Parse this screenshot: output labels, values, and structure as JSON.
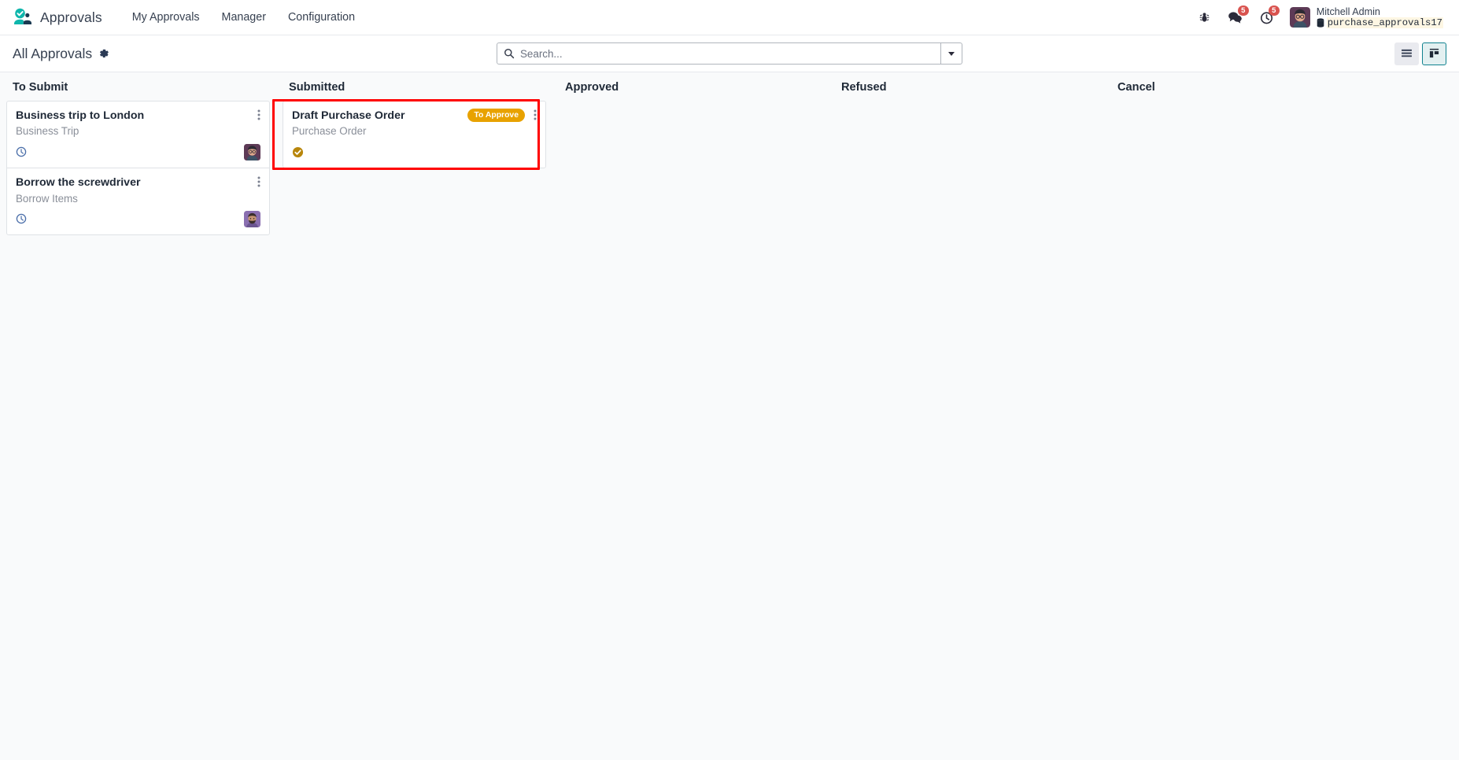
{
  "navbar": {
    "brand": "Approvals",
    "brand_logo_icon": "approvals-person-check-logo",
    "menu_items": [
      {
        "label": "My Approvals",
        "name": "my-approvals"
      },
      {
        "label": "Manager",
        "name": "manager"
      },
      {
        "label": "Configuration",
        "name": "configuration"
      }
    ],
    "systray": {
      "debug_icon": "bug-icon",
      "messages_icon": "messages-icon",
      "messages_count": "5",
      "activities_icon": "clock-activity-icon",
      "activities_count": "5"
    },
    "user": {
      "avatar_icon": "user-avatar",
      "name": "Mitchell Admin",
      "database_icon": "database-icon",
      "database": "purchase_approvals17"
    }
  },
  "control_panel": {
    "breadcrumb_title": "All Approvals",
    "gear_icon": "gear-icon",
    "search": {
      "icon": "search-icon",
      "placeholder": "Search...",
      "value": "",
      "toggle_icon": "chevron-down-icon"
    },
    "view_switcher": [
      {
        "name": "list-view",
        "icon": "list-icon",
        "active": false
      },
      {
        "name": "kanban-view",
        "icon": "kanban-icon",
        "active": true
      }
    ]
  },
  "kanban": {
    "columns": [
      {
        "title": "To Submit",
        "name": "to-submit",
        "cards": [
          {
            "title": "Business trip to London",
            "subtitle": "Business Trip",
            "badge": "",
            "footer_icon": "clock-icon",
            "avatar_icon": "avatar-mitchell-admin",
            "menu_icon": "kebab-menu-icon"
          },
          {
            "title": "Borrow the screwdriver",
            "subtitle": "Borrow Items",
            "badge": "",
            "footer_icon": "clock-icon",
            "avatar_icon": "avatar-user-purple",
            "menu_icon": "kebab-menu-icon"
          }
        ]
      },
      {
        "title": "Submitted",
        "name": "submitted",
        "cards": [
          {
            "title": "Draft Purchase Order",
            "subtitle": "Purchase Order",
            "badge": "To Approve",
            "footer_icon": "check-circle-icon",
            "avatar_icon": "",
            "menu_icon": "kebab-menu-icon"
          }
        ]
      },
      {
        "title": "Approved",
        "name": "approved",
        "cards": []
      },
      {
        "title": "Refused",
        "name": "refused",
        "cards": []
      },
      {
        "title": "Cancel",
        "name": "cancel",
        "cards": []
      }
    ]
  },
  "colors": {
    "brand_teal": "#10828f",
    "badge_orange": "#e8a200",
    "check_gold": "#b8860b",
    "clock_blue": "#4a6ea9",
    "highlight_red": "#ff0000",
    "notification_red": "#d9534f"
  }
}
